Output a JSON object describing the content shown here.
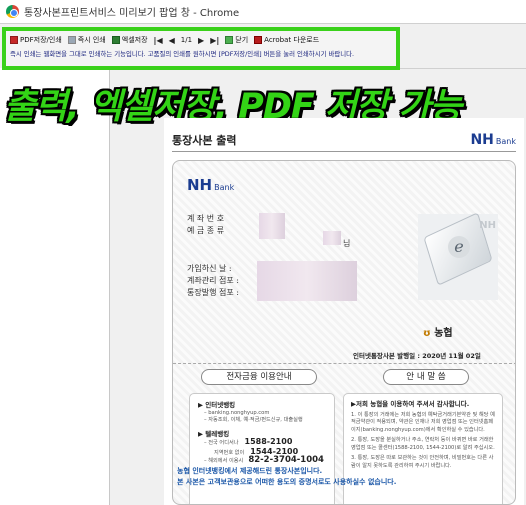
{
  "window": {
    "title": "통장사본프린트서비스 미리보기 팝업 창 - Chrome"
  },
  "toolbar": {
    "pdf_save": "PDF저장/인쇄",
    "print": "즉시 인쇄",
    "excel_save": "엑셀저장",
    "page_indicator": "1/1",
    "close": "닫기",
    "acrobat_download": "Acrobat 다운로드",
    "notice": "즉시 인쇄는 웹화면을 그대로 인쇄하는 기능입니다. 고품질의 인쇄를 원하시면 [PDF저장/인쇄] 버튼을 눌러 인쇄하시기 바랍니다."
  },
  "caption": "출력, 엑셀저장, PDF 저장 가능",
  "document": {
    "header_title": "통장사본 출력",
    "brand": "NH",
    "brand_sub": "Bank",
    "labels_top": [
      "계 좌 번 호",
      "예 금 종 류"
    ],
    "nim_suffix": "님",
    "labels_mid": [
      "가입하신 날 :",
      "계좌관리 점포 :",
      "통장발행 점포 :"
    ],
    "nonghyup_logo": "농협",
    "issue_date": "인터넷통장사본 발행일 : 2020년 11월 02일",
    "ebanking_banner": "전자금융 이용안내",
    "notice_banner": "안 내 말 씀",
    "internet_banking_title": "▶ 인터넷뱅킹",
    "internet_banking_items": [
      "– banking.nonghyup.com",
      "– 자동조회, 이체, 예·적금/펀드신규, 대출실행"
    ],
    "telebanking_title": "▶ 텔레뱅킹",
    "telebanking_line1_label": "– 전국 어디서나",
    "telebanking_line1_number": "1588-2100",
    "telebanking_line2_label": "지역번호 없이",
    "telebanking_line2_number": "1544-2100",
    "telebanking_line3_label": "– 해외에서 이용시",
    "telebanking_line3_number": "82-2-3704-1004",
    "notice_title": "▶저희 농협을 이용하여 주셔서 감사합니다.",
    "notice_items": [
      "1. 이 통장의 거래에는 저희 농협의 예탁금거래기본약관 및 해당 예적금약관이 적용되며, 약관은 인재나 저희 영업점 또는 인터넷홈페이지(banking.nonghyup.com)에서 확인하실 수 있습니다.",
      "2. 통장, 도장을 분실하거나 주소, 연락처 등이 바뀌면 바로 거래한 영업점 또는 콜센터(1588-2100, 1544-2100)로 알려 주십시오.",
      "3. 통장, 도장은 따로 보관하는 것이 안전하며, 비밀번호는 다른 사람이 알지 못하도록 관리하여 주시기 바랍니다."
    ],
    "footer_line1": "농협 인터넷뱅킹에서 제공해드린 통장사본입니다.",
    "footer_line2": "본 사본은 고객보관용으로 어떠한 용도의 증명서로도 사용하실수 없습니다."
  },
  "colors": {
    "highlight_green": "#3ad11a",
    "nh_blue": "#1b3c90",
    "footer_blue": "#1b57a8"
  }
}
